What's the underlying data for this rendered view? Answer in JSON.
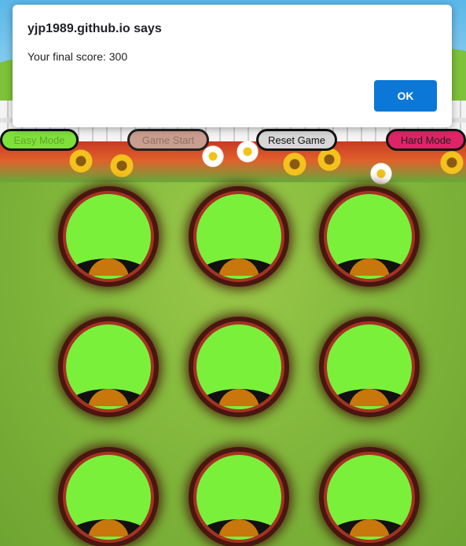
{
  "dialog": {
    "title": "yjp1989.github.io says",
    "message": "Your final score: 300",
    "ok_label": "OK"
  },
  "controls": {
    "easy_label": "Easy Mode",
    "start_label": "Game Start",
    "reset_label": "Reset Game",
    "hard_label": "Hard Mode"
  },
  "board": {
    "hole_count": 9
  },
  "colors": {
    "accent_blue": "#0b77d6",
    "easy": "#7fe03b",
    "hard": "#dd2466",
    "hole_fill": "#7af03b",
    "hole_border": "#a43322",
    "dirt": "#c7770c"
  }
}
